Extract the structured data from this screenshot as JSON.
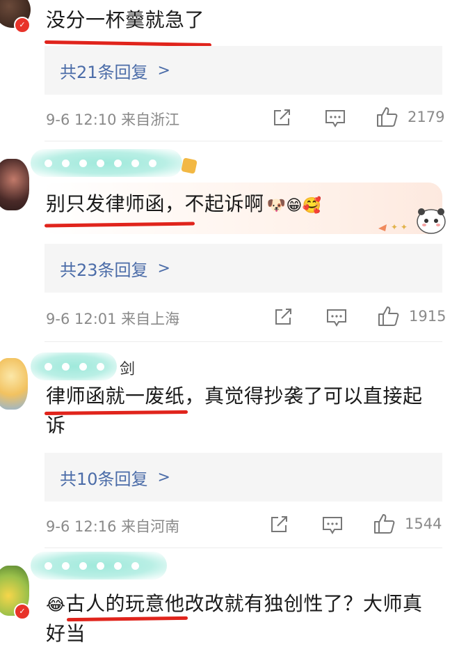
{
  "comments": [
    {
      "text": "没分一杯羹就急了",
      "replies_label": "共21条回复",
      "meta": "9-6 12:10 来自浙江",
      "likes": "2179"
    },
    {
      "text": "别只发律师函，不起诉啊",
      "emoji": "🐶😁🥰",
      "replies_label": "共23条回复",
      "meta": "9-6 12:01 来自上海",
      "likes": "1915"
    },
    {
      "nick_tail": "剑",
      "text": "律师函就一废纸，真觉得抄袭了可以直接起诉",
      "replies_label": "共10条回复",
      "meta": "9-6 12:16 来自河南",
      "likes": "1544"
    },
    {
      "emoji_prefix": "😂",
      "text": "古人的玩意他改改就有独创性了？大师真好当"
    }
  ],
  "icons": {
    "share": "share-icon",
    "comment": "comment-icon",
    "like": "thumbs-up-icon",
    "chevron": "chevron-right-icon",
    "verified": "verified-badge-icon"
  },
  "colors": {
    "underline": "#e0241c",
    "link": "#4b6ca8",
    "meta": "#8a8a8a",
    "nickname_blur": "#a9ece0"
  }
}
